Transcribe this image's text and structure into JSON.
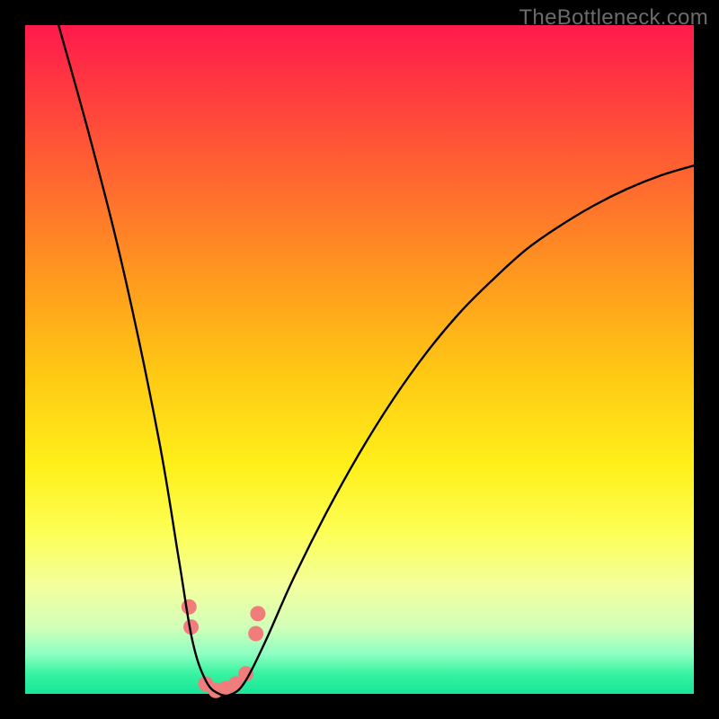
{
  "watermark": "TheBottleneck.com",
  "chart_data": {
    "type": "line",
    "title": "",
    "xlabel": "",
    "ylabel": "",
    "xlim": [
      0,
      100
    ],
    "ylim": [
      0,
      100
    ],
    "grid": false,
    "legend": false,
    "description": "Single black V-shaped curve over a vertical red→yellow→green gradient; minimum near x≈28, y≈0. Pink dot markers near the trough. Axes are unlabeled (black frame only).",
    "series": [
      {
        "name": "bottleneck-curve",
        "color": "#000000",
        "x": [
          5,
          10,
          15,
          20,
          23,
          25,
          27,
          29,
          31,
          33,
          36,
          40,
          45,
          50,
          55,
          60,
          65,
          70,
          75,
          80,
          85,
          90,
          95,
          100
        ],
        "y": [
          100,
          82,
          62,
          38,
          20,
          8,
          2,
          0,
          0,
          2,
          8,
          17,
          27,
          36,
          44,
          51,
          57,
          62,
          66.5,
          70,
          73,
          75.5,
          77.5,
          79
        ]
      }
    ],
    "markers": {
      "name": "trough-dots",
      "color": "#f07c7c",
      "points": [
        {
          "x": 24.5,
          "y": 13
        },
        {
          "x": 24.8,
          "y": 10
        },
        {
          "x": 27.0,
          "y": 1.5
        },
        {
          "x": 28.5,
          "y": 0.5
        },
        {
          "x": 30.0,
          "y": 0.8
        },
        {
          "x": 31.5,
          "y": 1.5
        },
        {
          "x": 33.0,
          "y": 3
        },
        {
          "x": 34.5,
          "y": 9
        },
        {
          "x": 34.8,
          "y": 12
        }
      ]
    },
    "gradient_stops": [
      {
        "pos": 0.0,
        "color": "#ff1a4d"
      },
      {
        "pos": 0.1,
        "color": "#ff3b3f"
      },
      {
        "pos": 0.24,
        "color": "#ff6a2f"
      },
      {
        "pos": 0.38,
        "color": "#ff9a1e"
      },
      {
        "pos": 0.52,
        "color": "#ffc814"
      },
      {
        "pos": 0.66,
        "color": "#fff01a"
      },
      {
        "pos": 0.76,
        "color": "#fdff57"
      },
      {
        "pos": 0.84,
        "color": "#f3ff9e"
      },
      {
        "pos": 0.9,
        "color": "#d2ffb8"
      },
      {
        "pos": 0.94,
        "color": "#8effc2"
      },
      {
        "pos": 0.97,
        "color": "#37f3a1"
      },
      {
        "pos": 1.0,
        "color": "#17e699"
      }
    ]
  }
}
